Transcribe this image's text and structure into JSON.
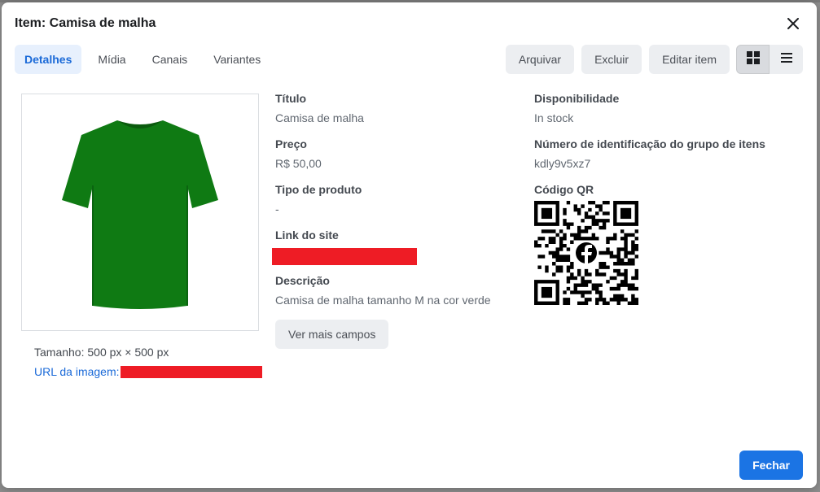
{
  "modal": {
    "title": "Item: Camisa de malha",
    "close_icon": "close-icon"
  },
  "tabs": [
    {
      "label": "Detalhes",
      "active": true
    },
    {
      "label": "Mídia",
      "active": false
    },
    {
      "label": "Canais",
      "active": false
    },
    {
      "label": "Variantes",
      "active": false
    }
  ],
  "actions": {
    "archive": "Arquivar",
    "delete": "Excluir",
    "edit": "Editar item",
    "grid_view_icon": "grid-icon",
    "list_view_icon": "list-icon"
  },
  "image": {
    "description_icon": "green-tshirt-image",
    "size_text": "Tamanho: 500 px × 500 px",
    "url_label": "URL da imagem:"
  },
  "fields_left": {
    "title_label": "Título",
    "title_value": "Camisa de malha",
    "price_label": "Preço",
    "price_value": "R$ 50,00",
    "type_label": "Tipo de produto",
    "type_value": "-",
    "link_label": "Link do site",
    "description_label": "Descrição",
    "description_value": "Camisa de malha tamanho M na cor verde",
    "more_button": "Ver mais campos"
  },
  "fields_right": {
    "availability_label": "Disponibilidade",
    "availability_value": "In stock",
    "group_id_label": "Número de identificação do grupo de itens",
    "group_id_value": "kdly9v5xz7",
    "qr_label": "Código QR"
  },
  "footer": {
    "close_button": "Fechar"
  },
  "colors": {
    "accent": "#1b74e4",
    "redaction": "#ee1c25",
    "shirt": "#0f7a13"
  }
}
